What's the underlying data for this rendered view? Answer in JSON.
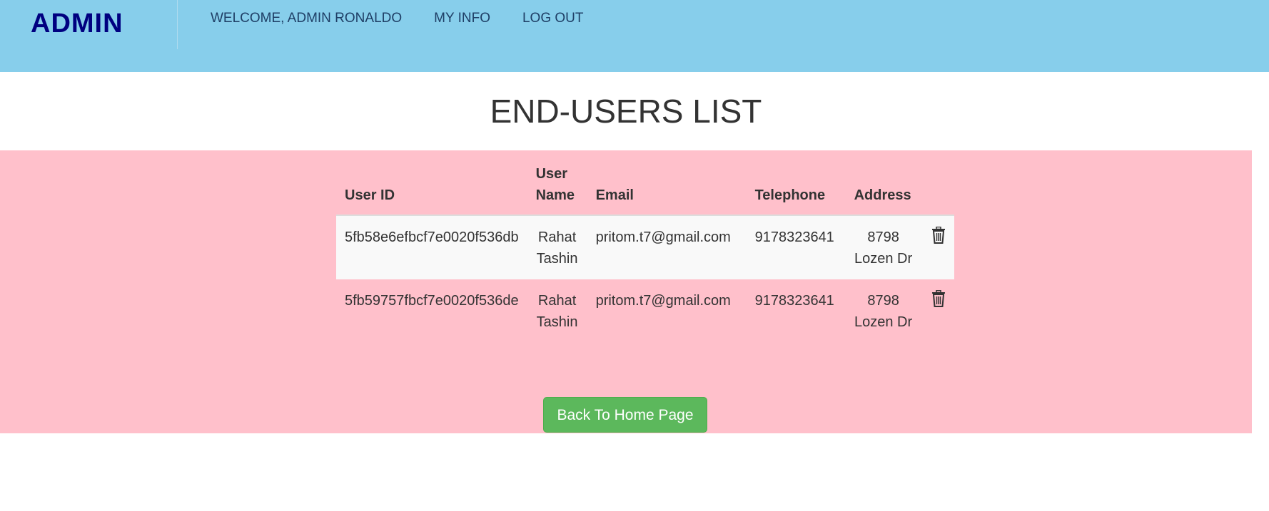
{
  "navbar": {
    "brand": "ADMIN",
    "links": [
      {
        "label": "WELCOME, ADMIN RONALDO"
      },
      {
        "label": "MY INFO"
      },
      {
        "label": "LOG OUT"
      }
    ],
    "background": "#87ceeb",
    "brand_color": "#000080"
  },
  "page": {
    "title": "END-USERS LIST",
    "content_background": "#ffc0cb"
  },
  "table": {
    "headers": {
      "user_id": "User ID",
      "user_name": "User Name",
      "email": "Email",
      "telephone": "Telephone",
      "address": "Address"
    },
    "rows": [
      {
        "user_id": "5fb58e6efbcf7e0020f536db",
        "user_name": "Rahat Tashin",
        "email": "pritom.t7@gmail.com",
        "telephone": "9178323641",
        "address": "8798 Lozen Dr",
        "action_icon": "trash-icon"
      },
      {
        "user_id": "5fb59757fbcf7e0020f536de",
        "user_name": "Rahat Tashin",
        "email": "pritom.t7@gmail.com",
        "telephone": "9178323641",
        "address": "8798 Lozen Dr",
        "action_icon": "trash-icon"
      }
    ]
  },
  "actions": {
    "back_home_label": "Back To Home Page",
    "button_color": "#5cb85c"
  }
}
